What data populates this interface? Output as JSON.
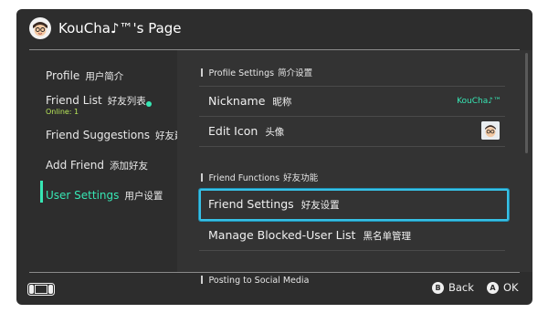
{
  "header": {
    "title": "KouCha♪™'s Page",
    "avatar_icon": "mii-avatar-icon"
  },
  "sidebar": {
    "items": [
      {
        "label": "Profile",
        "label_cn": "用户简介"
      },
      {
        "label": "Friend List",
        "label_cn": "好友列表",
        "sub": "Online: 1"
      },
      {
        "label": "Friend Suggestions",
        "label_cn": "好友建议"
      },
      {
        "label": "Add Friend",
        "label_cn": "添加好友"
      },
      {
        "label": "User Settings",
        "label_cn": "用户设置",
        "active": true
      }
    ]
  },
  "content": {
    "profile_settings": {
      "heading": "Profile Settings",
      "heading_cn": "简介设置",
      "nickname": {
        "label": "Nickname",
        "label_cn": "昵称",
        "value": "KouCha♪™"
      },
      "edit_icon": {
        "label": "Edit Icon",
        "label_cn": "头像"
      }
    },
    "friend_functions": {
      "heading": "Friend Functions",
      "heading_cn": "好友功能",
      "friend_settings": {
        "label": "Friend Settings",
        "label_cn": "好友设置"
      },
      "blocked": {
        "label": "Manage Blocked-User List",
        "label_cn": "黑名单管理"
      }
    },
    "posting": {
      "heading": "Posting to Social Media"
    }
  },
  "footer": {
    "back_button": "B",
    "back_label": "Back",
    "ok_button": "A",
    "ok_label": "OK",
    "console_icon": "switch-console-icon"
  },
  "colors": {
    "accent": "#37e6b4",
    "selection": "#37c1e6",
    "online": "#b8e659",
    "background": "#2d2d2d"
  }
}
